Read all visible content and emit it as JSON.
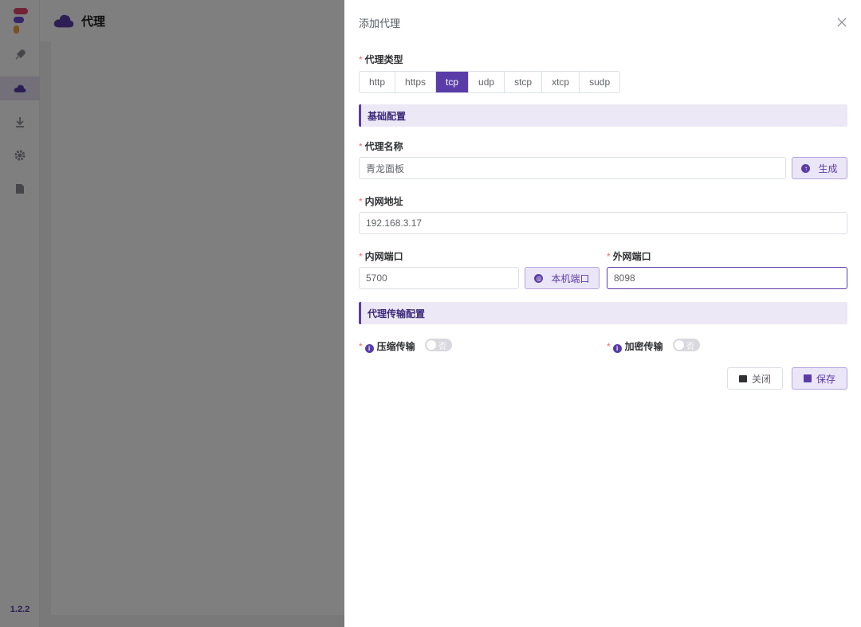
{
  "app": {
    "version": "1.2.2",
    "page_title": "代理",
    "sidebar_icons": [
      "rocket-icon",
      "cloud-icon",
      "download-icon",
      "gear-icon",
      "document-icon"
    ]
  },
  "drawer": {
    "title": "添加代理",
    "type_label": "代理类型",
    "types": [
      "http",
      "https",
      "tcp",
      "udp",
      "stcp",
      "xtcp",
      "sudp"
    ],
    "selected_type": "tcp",
    "basic_section": "基础配置",
    "name_label": "代理名称",
    "name_value": "青龙面板",
    "generate_button": "生成",
    "local_ip_label": "内网地址",
    "local_ip_value": "192.168.3.17",
    "local_port_label": "内网端口",
    "local_port_value": "5700",
    "local_port_button": "本机端口",
    "remote_port_label": "外网端口",
    "remote_port_value": "8098",
    "transport_section": "代理传输配置",
    "compress_label": "压缩传输",
    "compress_state": "否",
    "encrypt_label": "加密传输",
    "encrypt_state": "否",
    "close_button": "关闭",
    "save_button": "保存",
    "required_mark": "*"
  },
  "colors": {
    "accent": "#5a3ca8",
    "accent_light": "#ece8f6",
    "required": "#f56c6c"
  }
}
